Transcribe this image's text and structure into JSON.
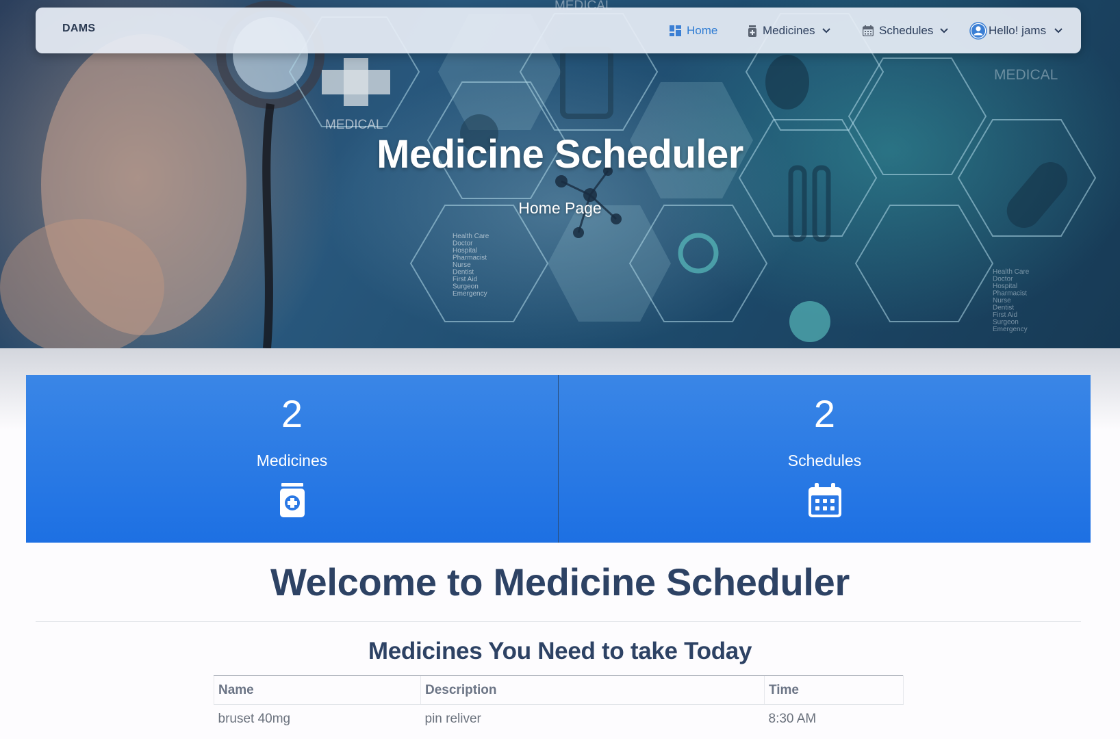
{
  "navbar": {
    "brand": "DAMS",
    "home": "Home",
    "medicines": "Medicines",
    "schedules": "Schedules",
    "user": "Hello! jams"
  },
  "hero": {
    "title": "Medicine Scheduler",
    "subtitle": "Home Page",
    "background_text": {
      "medical_1": "MEDICAL",
      "medical_2": "MEDICAL",
      "medical_3": "MEDICAL",
      "list_1": [
        "Health Care",
        "Doctor",
        "Hospital",
        "Pharmacist",
        "Nurse",
        "Dentist",
        "First Aid",
        "Surgeon",
        "Emergency"
      ],
      "list_2": [
        "Health Care",
        "Doctor",
        "Hospital",
        "Pharmacist",
        "Nurse",
        "Dentist",
        "First Aid",
        "Surgeon",
        "Emergency"
      ]
    }
  },
  "stats": [
    {
      "count": "2",
      "label": "Medicines",
      "icon": "medicine-bottle-icon"
    },
    {
      "count": "2",
      "label": "Schedules",
      "icon": "calendar-icon"
    }
  ],
  "welcome": "Welcome to Medicine Scheduler",
  "today": {
    "title": "Medicines You Need to take Today",
    "columns": [
      "Name",
      "Description",
      "Time"
    ],
    "rows": [
      [
        "bruset 40mg",
        "pin reliver",
        "8:30 AM"
      ]
    ]
  },
  "colors": {
    "accent": "#2f7cd3",
    "card": "#2b7ae5",
    "heading": "#2d4264"
  }
}
